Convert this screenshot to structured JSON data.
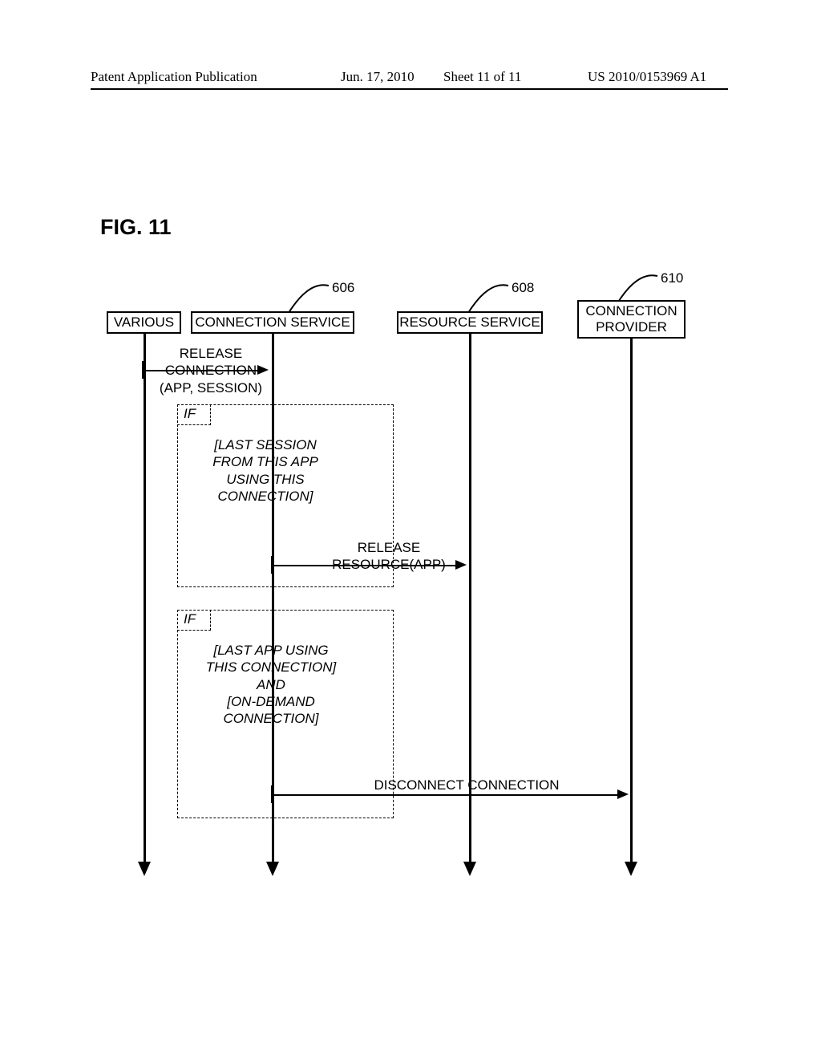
{
  "header": {
    "left": "Patent Application Publication",
    "center": "Jun. 17, 2010",
    "sheet": "Sheet 11 of 11",
    "right": "US 2010/0153969 A1"
  },
  "figure_label": "FIG. 11",
  "refs": {
    "r606": "606",
    "r608": "608",
    "r610": "610"
  },
  "lifelines": {
    "various": "VARIOUS",
    "connection_service": "CONNECTION SERVICE",
    "resource_service": "RESOURCE SERVICE",
    "connection_provider_l1": "CONNECTION",
    "connection_provider_l2": "PROVIDER"
  },
  "messages": {
    "release_connection_l1": "RELEASE",
    "release_connection_l2": "CONNECTION",
    "release_connection_l3": "(APP, SESSION)",
    "if_label": "IF",
    "cond1_l1": "[LAST SESSION",
    "cond1_l2": "FROM THIS APP",
    "cond1_l3": "USING THIS",
    "cond1_l4": "CONNECTION]",
    "release_resource_l1": "RELEASE",
    "release_resource_l2": "RESOURCE(APP)",
    "cond2_l1": "[LAST APP USING",
    "cond2_l2": "THIS CONNECTION]",
    "cond2_l3": "AND",
    "cond2_l4": "[ON-DEMAND",
    "cond2_l5": "CONNECTION]",
    "disconnect": "DISCONNECT CONNECTION"
  }
}
